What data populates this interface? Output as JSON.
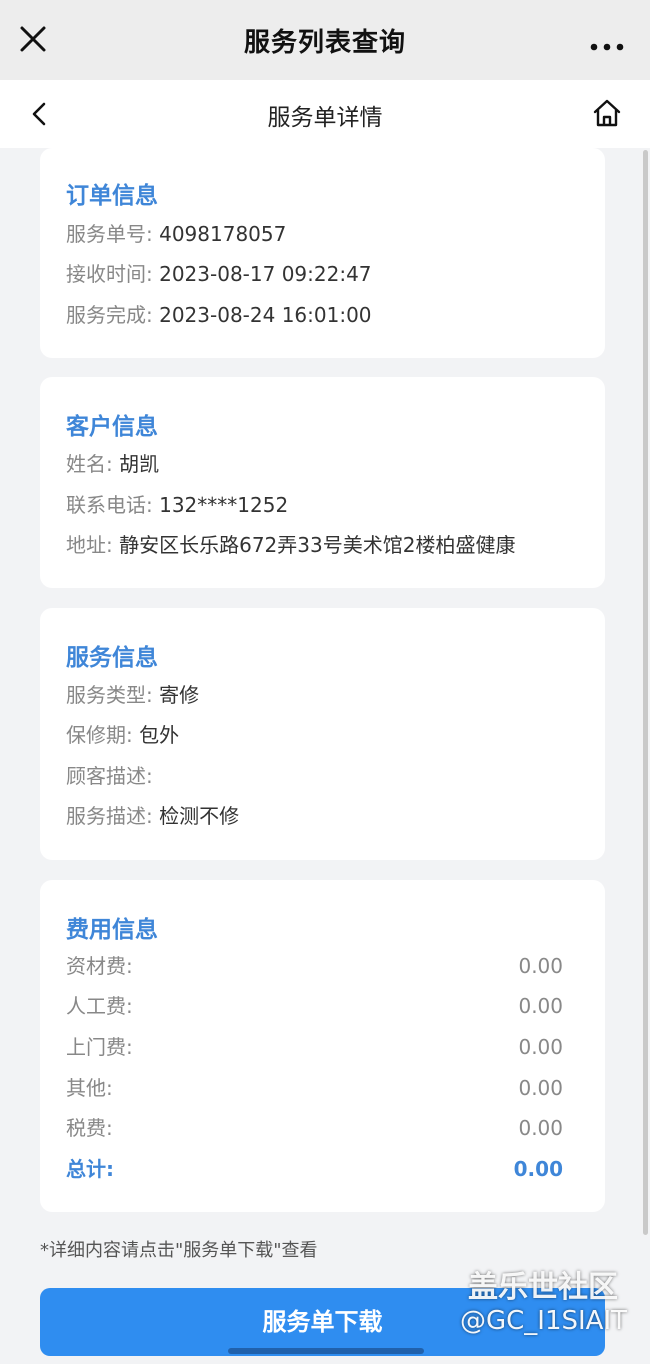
{
  "app": {
    "title": "服务列表查询"
  },
  "nav": {
    "title": "服务单详情"
  },
  "order": {
    "heading": "订单信息",
    "rows": [
      {
        "label": "服务单号:",
        "value": "4098178057"
      },
      {
        "label": "接收时间:",
        "value": "2023-08-17 09:22:47"
      },
      {
        "label": "服务完成:",
        "value": "2023-08-24 16:01:00"
      }
    ]
  },
  "customer": {
    "heading": "客户信息",
    "rows": [
      {
        "label": "姓名:",
        "value": "胡凯"
      },
      {
        "label": "联系电话:",
        "value": "132****1252"
      },
      {
        "label": "地址:",
        "value": "静安区长乐路672弄33号美术馆2楼柏盛健康"
      }
    ]
  },
  "service": {
    "heading": "服务信息",
    "rows": [
      {
        "label": "服务类型:",
        "value": "寄修"
      },
      {
        "label": "保修期:",
        "value": "包外"
      },
      {
        "label": "顾客描述:",
        "value": ""
      },
      {
        "label": "服务描述:",
        "value": "检测不修"
      }
    ]
  },
  "fees": {
    "heading": "费用信息",
    "rows": [
      {
        "label": "资材费:",
        "value": "0.00"
      },
      {
        "label": "人工费:",
        "value": "0.00"
      },
      {
        "label": "上门费:",
        "value": "0.00"
      },
      {
        "label": "其他:",
        "value": "0.00"
      },
      {
        "label": "税费:",
        "value": "0.00"
      }
    ],
    "total": {
      "label": "总计:",
      "value": "0.00"
    }
  },
  "note": "*详细内容请点击\"服务单下载\"查看",
  "download_label": "服务单下载",
  "watermark": {
    "line1": "盖乐世社区",
    "line2": "@GC_I1SIAIT"
  },
  "icons": {
    "close": "close-icon",
    "more": "more-icon",
    "back": "back-icon",
    "home": "home-icon"
  },
  "colors": {
    "accent": "#3f86d8",
    "button": "#2f8df0",
    "background": "#f2f3f5"
  }
}
